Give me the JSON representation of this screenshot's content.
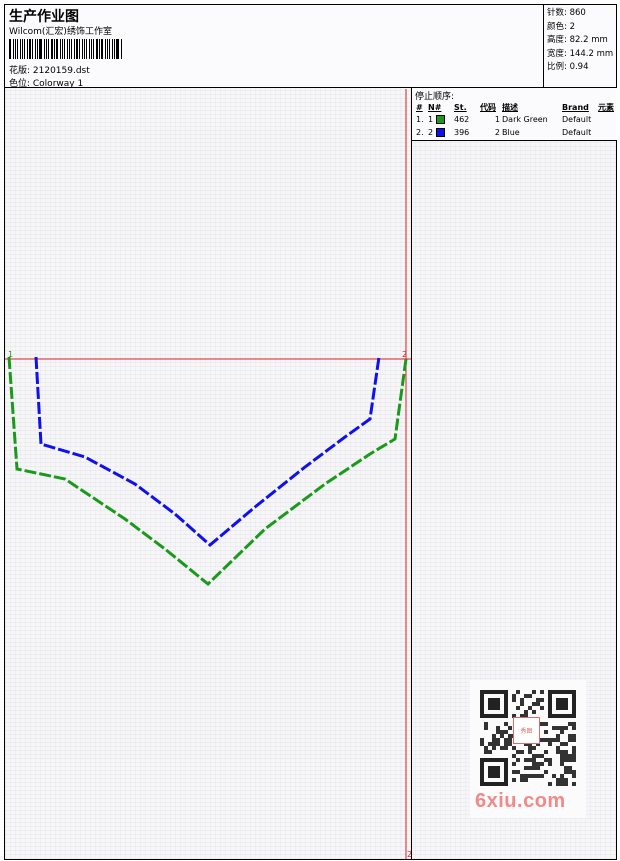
{
  "header": {
    "title": "生产作业图",
    "subtitle": "Wilcom(汇宏)绣饰工作室",
    "design_file": "花版: 2120159.dst",
    "colorway": "色位: Colorway 1"
  },
  "stats": {
    "stitches": "针数: 860",
    "colors": "颜色: 2",
    "height": "高度: 82.2 mm",
    "width": "宽度: 144.2 mm",
    "scale": "比例: 0.94"
  },
  "stop_sequence": {
    "title": "停止顺序:",
    "headers": [
      "#",
      "N#",
      "St.",
      "代码",
      "描述",
      "Brand",
      "元素"
    ],
    "rows": [
      {
        "index": "1.",
        "n": "1",
        "color": "#1a9a1a",
        "stitches": "462",
        "code": "1",
        "desc": "Dark Green",
        "brand": "Default",
        "element": ""
      },
      {
        "index": "2.",
        "n": "2",
        "color": "#1010ee",
        "stitches": "396",
        "code": "2",
        "desc": "Blue",
        "brand": "Default",
        "element": ""
      }
    ]
  },
  "markers": {
    "start": "1",
    "end": "2",
    "bottom": "2"
  },
  "colors": {
    "green": "#1a9a1a",
    "blue": "#1010ee",
    "guide": "#e02020"
  },
  "watermark": {
    "text": "6xiu.com",
    "logo": "秀图"
  }
}
